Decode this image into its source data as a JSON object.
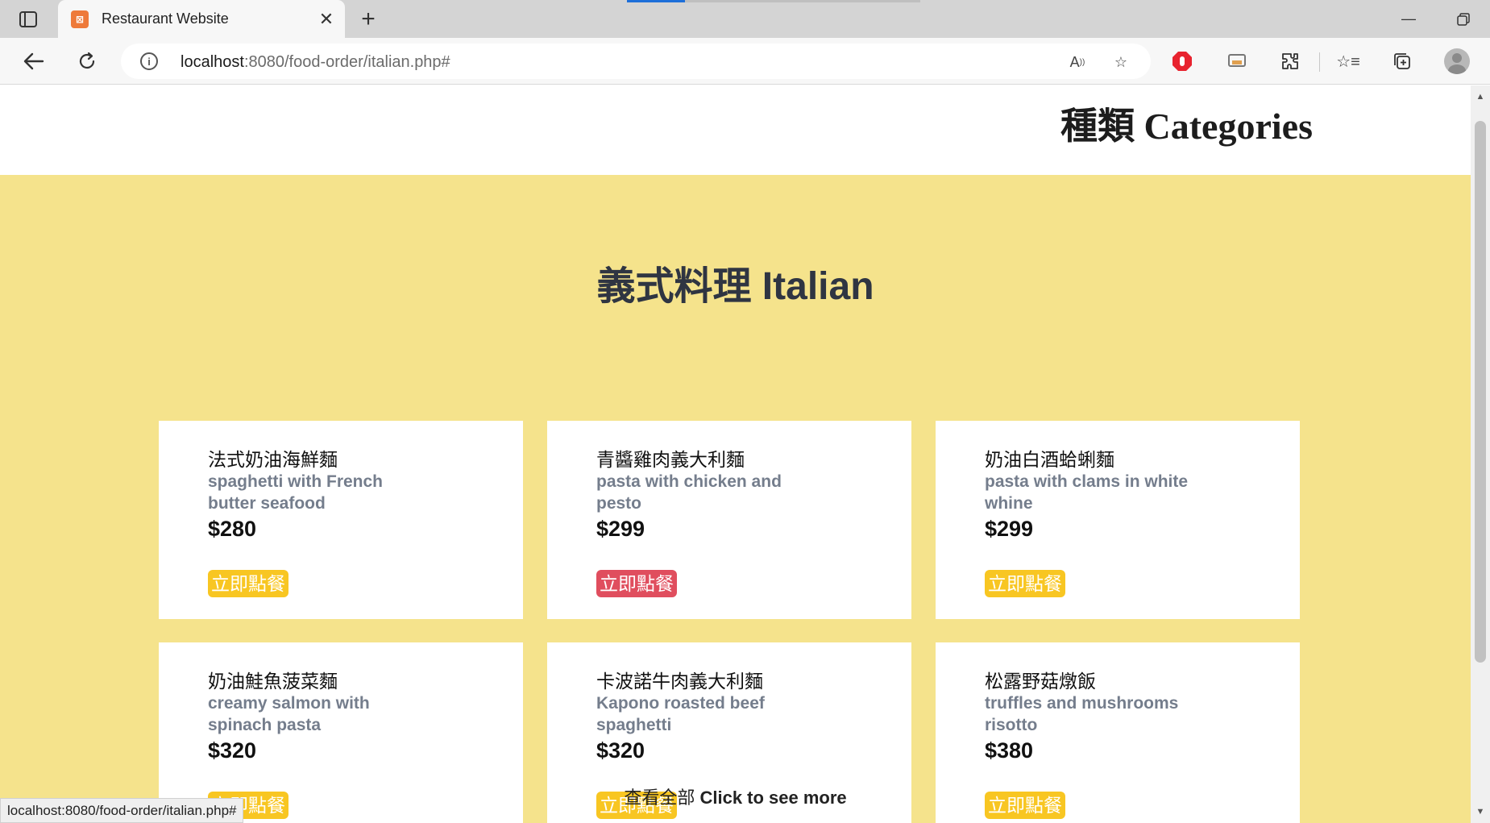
{
  "browser": {
    "tab_title": "Restaurant Website",
    "favicon_text": "⊠",
    "url_host": "localhost",
    "url_rest": ":8080/food-order/italian.php#",
    "status_url": "localhost:8080/food-order/italian.php#"
  },
  "page": {
    "categories_heading": "種類 Categories",
    "section_title": "義式料理 Italian",
    "see_more_zh": "查看全部",
    "see_more_en": "Click to see more",
    "background_color": "#f5e38c"
  },
  "foods": [
    {
      "name_zh": "法式奶油海鮮麵",
      "name_en": "spaghetti with French butter seafood",
      "price": "$280",
      "order_label": "立即點餐"
    },
    {
      "name_zh": "青醬雞肉義大利麵",
      "name_en": "pasta with chicken and pesto",
      "price": "$299",
      "order_label": "立即點餐"
    },
    {
      "name_zh": "奶油白酒蛤蜊麵",
      "name_en": "pasta with clams in white whine",
      "price": "$299",
      "order_label": "立即點餐"
    },
    {
      "name_zh": "奶油鮭魚菠菜麵",
      "name_en": "creamy salmon with spinach pasta",
      "price": "$320",
      "order_label": "立即點餐"
    },
    {
      "name_zh": "卡波諾牛肉義大利麵",
      "name_en": "Kapono roasted beef spaghetti",
      "price": "$320",
      "order_label": "立即點餐"
    },
    {
      "name_zh": "松露野菇燉飯",
      "name_en": "truffles and mushrooms risotto",
      "price": "$380",
      "order_label": "立即點餐"
    }
  ],
  "icons": {
    "back": "back-arrow-icon",
    "reload": "reload-icon",
    "read_aloud": "read-aloud-icon",
    "favorite_add": "add-favorite-icon",
    "adblock": "adblock-icon",
    "extensions": "puzzle-icon",
    "favorites": "favorites-icon",
    "collections": "collections-icon"
  }
}
